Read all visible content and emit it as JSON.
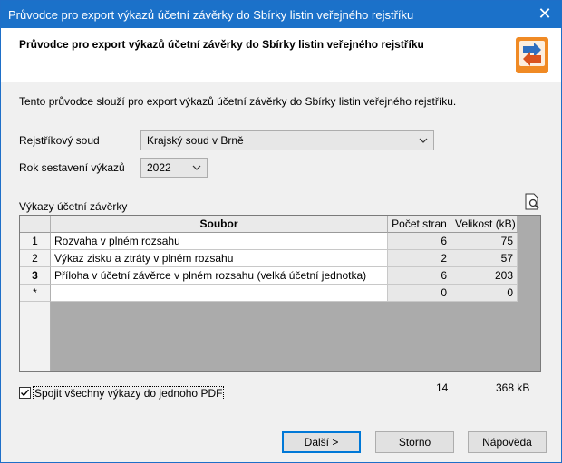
{
  "window": {
    "title": "Průvodce pro export výkazů účetní závěrky do Sbírky listin veřejného rejstříku"
  },
  "header": {
    "heading": "Průvodce pro export výkazů účetní závěrky do Sbírky listin veřejného rejstříku"
  },
  "intro": "Tento průvodce slouží pro export výkazů účetní závěrky do Sbírky listin veřejného rejstříku.",
  "form": {
    "court_label": "Rejstříkový soud",
    "court_value": "Krajský soud v Brně",
    "year_label": "Rok sestavení výkazů",
    "year_value": "2022"
  },
  "grid": {
    "label": "Výkazy účetní závěrky",
    "columns": [
      "Soubor",
      "Počet stran",
      "Velikost (kB)"
    ],
    "rows": [
      {
        "n": "1",
        "file": "Rozvaha v plném rozsahu",
        "pages": "6",
        "size": "75"
      },
      {
        "n": "2",
        "file": "Výkaz zisku a ztráty v plném rozsahu",
        "pages": "2",
        "size": "57"
      },
      {
        "n": "3",
        "file": "Příloha v účetní závěrce v plném rozsahu (velká účetní jednotka)",
        "pages": "6",
        "size": "203"
      },
      {
        "n": "*",
        "file": "",
        "pages": "0",
        "size": "0"
      }
    ],
    "total_pages": "14",
    "total_size": "368 kB"
  },
  "merge": {
    "label": "Spojit všechny výkazy do jednoho PDF",
    "checked": true
  },
  "buttons": {
    "next": "Další >",
    "cancel": "Storno",
    "help": "Nápověda"
  }
}
